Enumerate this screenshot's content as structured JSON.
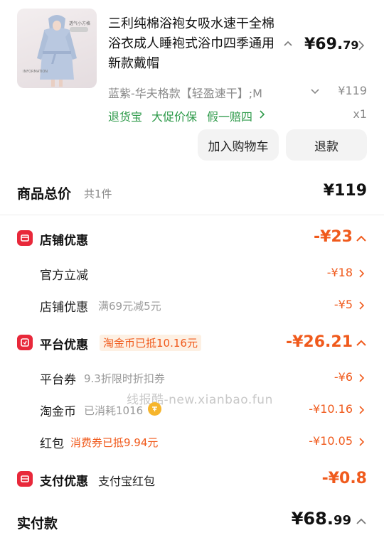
{
  "product": {
    "title": "三利纯棉浴袍女吸水速干全棉浴衣成人睡袍式浴巾四季通用新款戴帽",
    "price_int": "¥69.",
    "price_dec": "79",
    "sku": "蓝紫-华夫格款【轻盈速干】;M",
    "sku_price": "¥119",
    "service_tags": [
      "退货宝",
      "大促价保",
      "假一赔四"
    ],
    "quantity": "x1",
    "thumb_tag": "透气小方格",
    "thumb_info": "INFORMATION"
  },
  "actions": {
    "add_to_cart": "加入购物车",
    "refund": "退款"
  },
  "summary": {
    "total_label": "商品总价",
    "total_count": "共1件",
    "total_value": "¥119"
  },
  "shop_discount": {
    "label": "店铺优惠",
    "value": "-¥23",
    "items": [
      {
        "label": "官方立减",
        "sub": "",
        "value": "-¥18"
      },
      {
        "label": "店铺优惠",
        "sub": "满69元减5元",
        "value": "-¥5"
      }
    ]
  },
  "platform_discount": {
    "label": "平台优惠",
    "tag": "淘金币已抵10.16元",
    "value": "-¥26.21",
    "items": [
      {
        "label": "平台券",
        "sub": "9.3折限时折扣券",
        "value": "-¥6"
      },
      {
        "label": "淘金币",
        "sub": "已消耗1016",
        "value": "-¥10.16"
      },
      {
        "label": "红包",
        "sub": "消费券已抵9.94元",
        "value": "-¥10.05"
      }
    ]
  },
  "pay_discount": {
    "label": "支付优惠",
    "sub": "支付宝红包",
    "value": "-¥0.8"
  },
  "paid": {
    "label": "实付款",
    "value_int": "¥68.",
    "value_dec": "99"
  },
  "watermark": "线报酷-new.xianbao.fun",
  "colors": {
    "accent": "#f05a1c",
    "badge": "#e8283a",
    "green": "#2e9a4a"
  }
}
